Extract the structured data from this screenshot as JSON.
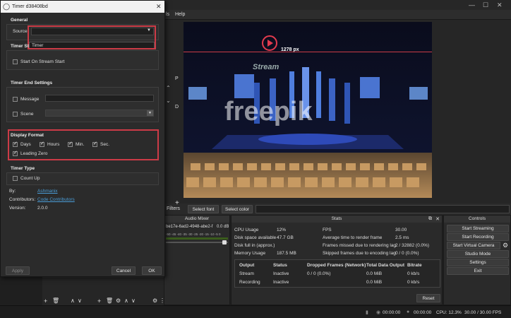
{
  "dialog": {
    "title": "Timer d38408bd",
    "general_heading": "General",
    "source_label": "Source",
    "source_value": "",
    "source_option": "Timer",
    "timer_start_heading": "Timer St",
    "start_on_stream_label": "Start On Stream Start",
    "timer_end_heading": "Timer End Settings",
    "message_label": "Message",
    "scene_label": "Scene",
    "display_format_heading": "Display Format",
    "days_label": "Days",
    "hours_label": "Hours",
    "min_label": "Min.",
    "sec_label": "Sec.",
    "leading_zero_label": "Leading Zero",
    "timer_type_heading": "Timer Type",
    "count_up_label": "Count Up",
    "by_label": "By:",
    "by_value": "Ashmanix",
    "contributors_label": "Contributors:",
    "contributors_value": "Code Contributors",
    "version_label": "Version:",
    "version_value": "2.0.0",
    "apply_label": "Apply",
    "cancel_label": "Cancel",
    "ok_label": "OK"
  },
  "menu": {
    "tools_tail": "ls",
    "help": "Help"
  },
  "preview": {
    "dim_label": "1278 px",
    "logo_text": "Stream",
    "watermark": "freepik"
  },
  "midbar": {
    "filters": "Filters",
    "select_font": "Select font",
    "select_color": "Select color"
  },
  "audio": {
    "title": "Audio Mixer",
    "source_id": "be17e-6ad2-4948-abe2-f",
    "db": "0.0 dB",
    "scale": "-50 -45 -40 -35 -30 -25 -20 -15 -10 -5 0"
  },
  "stats": {
    "title": "Stats",
    "cpu_label": "CPU Usage",
    "cpu_value": "12%",
    "disk_label": "Disk space available",
    "disk_value": "47.7 GB",
    "diskfull_label": "Disk full in (approx.)",
    "diskfull_value": "",
    "mem_label": "Memory Usage",
    "mem_value": "187.5 MB",
    "fps_label": "FPS",
    "fps_value": "30.00",
    "render_label": "Average time to render frame",
    "render_value": "2.5 ms",
    "missed_label": "Frames missed due to rendering lag",
    "missed_value": "2 / 32882 (0.0%)",
    "skipped_label": "Skipped frames due to encoding lag",
    "skipped_value": "0 / 0 (0.0%)",
    "headers": [
      "Output",
      "Status",
      "Dropped Frames (Network)",
      "Total Data Output",
      "Bitrate"
    ],
    "rows": [
      [
        "Stream",
        "Inactive",
        "0 / 0 (0.0%)",
        "0.0 MiB",
        "0 kb/s"
      ],
      [
        "Recording",
        "Inactive",
        "",
        "0.0 MiB",
        "0 kb/s"
      ]
    ],
    "reset_label": "Reset"
  },
  "controls": {
    "title": "Controls",
    "start_streaming": "Start Streaming",
    "start_recording": "Start Recording",
    "start_virtual_camera": "Start Virtual Camera",
    "studio_mode": "Studio Mode",
    "settings": "Settings",
    "exit": "Exit"
  },
  "status": {
    "stream_time": "00:00:00",
    "rec_time": "00:00:00",
    "cpu": "CPU: 12.3%",
    "fps": "30.00 / 30.00 FPS"
  },
  "side": {
    "p": "P",
    "d": "D"
  },
  "colors": {
    "highlight": "#cc3b47",
    "link": "#4a9cd6"
  }
}
